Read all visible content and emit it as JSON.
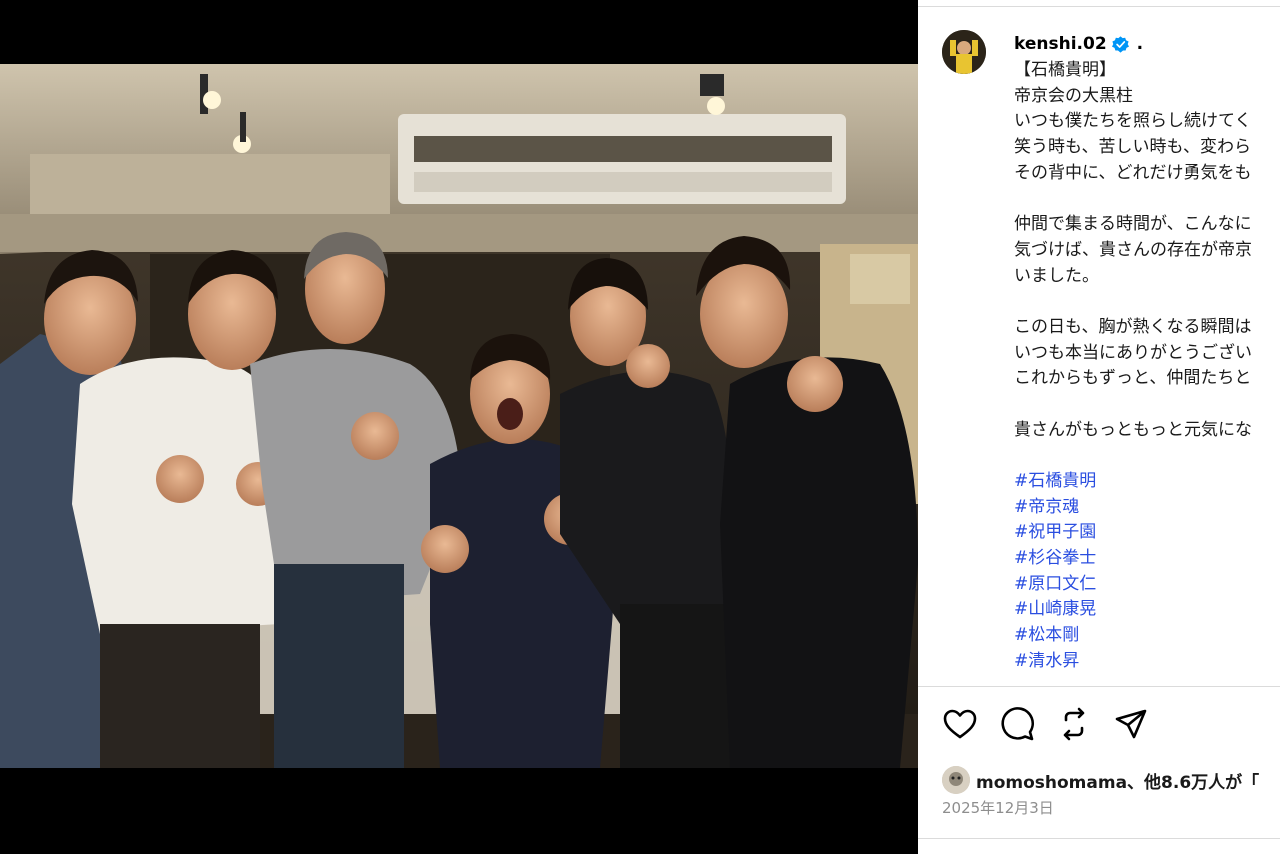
{
  "post": {
    "username": "kenshi.02",
    "separator": ".",
    "caption_lines": [
      "【石橋貴明】",
      "帝京会の大黒柱",
      "いつも僕たちを照らし続けてく",
      "笑う時も、苦しい時も、変わら",
      "その背中に、どれだけ勇気をも",
      "",
      "仲間で集まる時間が、こんなに",
      "気づけば、貴さんの存在が帝京",
      "いました。",
      "",
      "この日も、胸が熱くなる瞬間は",
      "いつも本当にありがとうござい",
      "これからもずっと、仲間たちと",
      "",
      "貴さんがもっともっと元気にな",
      ""
    ],
    "hashtags": [
      "#石橋貴明",
      "#帝京魂",
      "#祝甲子園",
      "#杉谷拳士",
      "#原口文仁",
      "#山崎康晃",
      "#松本剛",
      "#清水昇"
    ],
    "likes_text": "momoshomama、他8.6万人が「",
    "date": "2025年12月3日"
  },
  "icons": {
    "like": "heart-icon",
    "comment": "comment-icon",
    "share": "repost-icon",
    "send": "send-icon",
    "verified": "verified-badge-icon"
  },
  "colors": {
    "hashtag": "#2a4ee0",
    "verified": "#0095f6",
    "muted": "#8e8e8e"
  }
}
